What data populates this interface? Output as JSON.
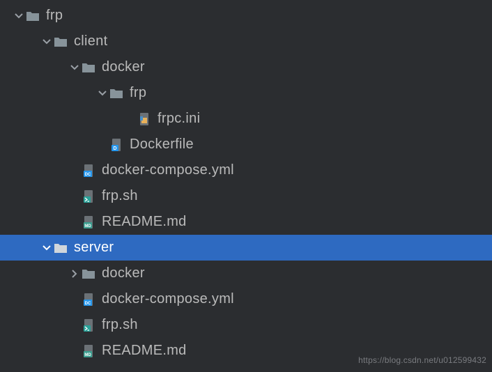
{
  "tree": {
    "n0": "frp",
    "n1": "client",
    "n2": "docker",
    "n3": "frp",
    "n4": "frpc.ini",
    "n5": "Dockerfile",
    "n6": "docker-compose.yml",
    "n7": "frp.sh",
    "n8": "README.md",
    "n9": "server",
    "n10": "docker",
    "n11": "docker-compose.yml",
    "n12": "frp.sh",
    "n13": "README.md"
  },
  "watermark": "https://blog.csdn.net/u012599432"
}
